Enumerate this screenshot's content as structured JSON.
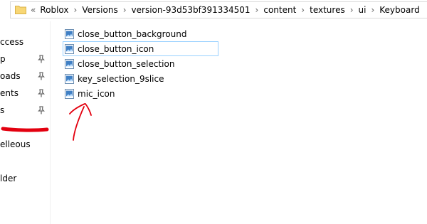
{
  "address_bar": {
    "lead": "«",
    "crumbs": [
      "Roblox",
      "Versions",
      "version-93d53bf391334501",
      "content",
      "textures",
      "ui",
      "Keyboard"
    ]
  },
  "nav": {
    "items": [
      {
        "label": "ccess",
        "pinned": false
      },
      {
        "label": "p",
        "pinned": true
      },
      {
        "label": "oads",
        "pinned": true
      },
      {
        "label": "ents",
        "pinned": true
      },
      {
        "label": "s",
        "pinned": true
      },
      {
        "label": "elleous",
        "pinned": false
      },
      {
        "label": "lder",
        "pinned": false
      }
    ]
  },
  "files": [
    {
      "name": "close_button_background",
      "selected": false
    },
    {
      "name": "close_button_icon",
      "selected": true
    },
    {
      "name": "close_button_selection",
      "selected": false
    },
    {
      "name": "key_selection_9slice",
      "selected": false
    },
    {
      "name": "mic_icon",
      "selected": false
    }
  ],
  "colors": {
    "annotation_red": "#e3000f",
    "selection_border": "#99d1ff",
    "folder_yellow": "#f8d775"
  }
}
